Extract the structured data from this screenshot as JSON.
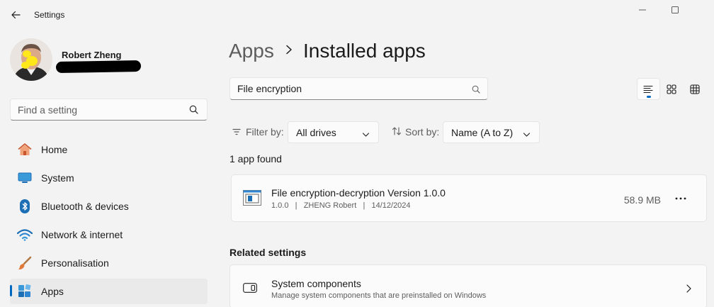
{
  "titlebar": {
    "app_title": "Settings",
    "icons": [
      "back-arrow-icon",
      "minimize-icon",
      "maximize-icon"
    ]
  },
  "profile": {
    "name": "Robert Zheng"
  },
  "sidebar": {
    "search_placeholder": "Find a setting",
    "items": [
      {
        "label": "Home",
        "icon": "home-icon"
      },
      {
        "label": "System",
        "icon": "system-icon"
      },
      {
        "label": "Bluetooth & devices",
        "icon": "bluetooth-icon"
      },
      {
        "label": "Network & internet",
        "icon": "wifi-icon"
      },
      {
        "label": "Personalisation",
        "icon": "brush-icon"
      },
      {
        "label": "Apps",
        "icon": "apps-icon",
        "active": true
      }
    ]
  },
  "header": {
    "parent": "Apps",
    "current": "Installed apps"
  },
  "search": {
    "value": "File encryption"
  },
  "filter": {
    "filter_label": "Filter by:",
    "filter_value": "All drives",
    "sort_label": "Sort by:",
    "sort_value": "Name (A to Z)"
  },
  "results": {
    "count_text": "1 app found",
    "apps": [
      {
        "name": "File encryption-decryption Version 1.0.0",
        "version": "1.0.0",
        "publisher": "ZHENG Robert",
        "date": "14/12/2024",
        "size": "58.9 MB"
      }
    ]
  },
  "related": {
    "title": "Related settings",
    "items": [
      {
        "title": "System components",
        "subtitle": "Manage system components that are preinstalled on Windows"
      }
    ]
  },
  "colors": {
    "accent": "#0067c0",
    "background": "#f3f3f3",
    "card": "#fbfbfb"
  }
}
